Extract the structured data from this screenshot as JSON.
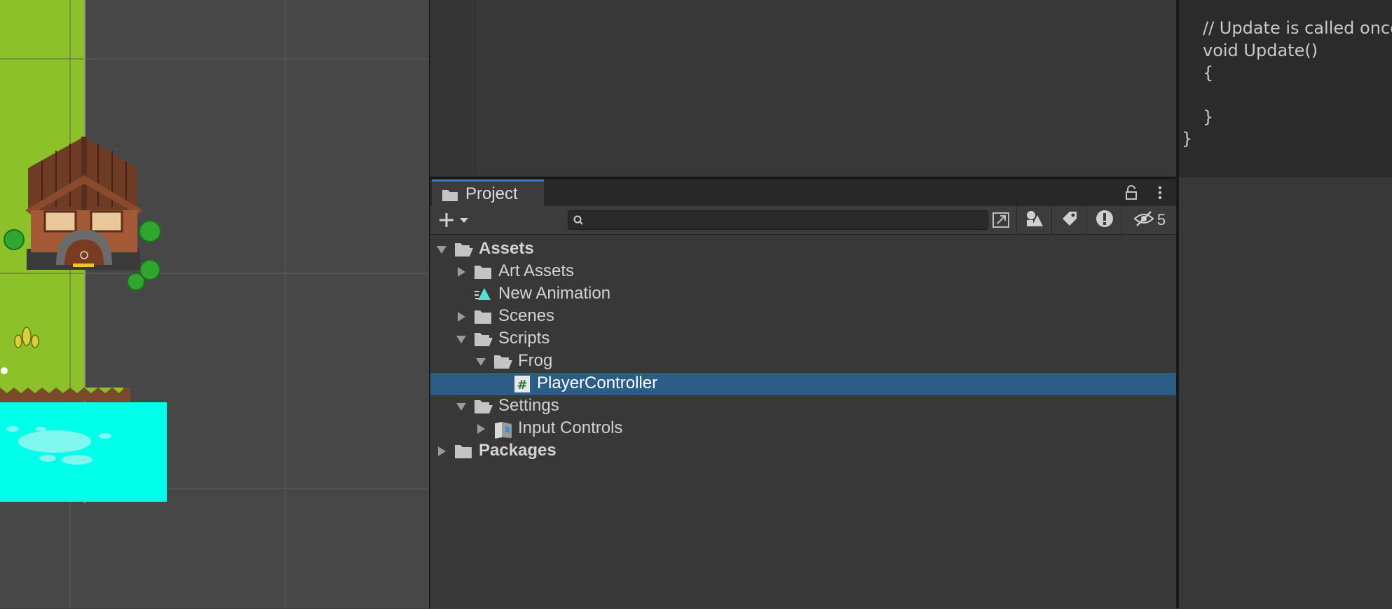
{
  "code": {
    "lines": [
      "// Update is called once per frame",
      "void Update()",
      "{",
      "",
      "}",
      "}"
    ]
  },
  "project": {
    "tab_label": "Project",
    "search": {
      "value": "",
      "placeholder": ""
    },
    "hidden_count": "5",
    "tree": [
      {
        "label": "Assets",
        "depth": 0,
        "expanded": true,
        "icon": "folder-open-icon",
        "bold": true
      },
      {
        "label": "Art Assets",
        "depth": 1,
        "expanded": false,
        "icon": "folder-icon"
      },
      {
        "label": "New Animation",
        "depth": 1,
        "icon": "animation-clip-icon"
      },
      {
        "label": "Scenes",
        "depth": 1,
        "expanded": false,
        "icon": "folder-icon"
      },
      {
        "label": "Scripts",
        "depth": 1,
        "expanded": true,
        "icon": "folder-open-icon"
      },
      {
        "label": "Frog",
        "depth": 2,
        "expanded": true,
        "icon": "folder-open-icon"
      },
      {
        "label": "PlayerController",
        "depth": 3,
        "icon": "csharp-script-icon",
        "selected": true
      },
      {
        "label": "Settings",
        "depth": 1,
        "expanded": true,
        "icon": "folder-open-icon"
      },
      {
        "label": "Input Controls",
        "depth": 2,
        "expanded": false,
        "icon": "input-actions-icon"
      },
      {
        "label": "Packages",
        "depth": 0,
        "expanded": false,
        "icon": "folder-icon",
        "bold": true
      }
    ]
  },
  "colors": {
    "selection": "#2c5d87",
    "tab_accent": "#3a79bb",
    "grass": "#8dc12a",
    "water": "#00ffe8"
  }
}
